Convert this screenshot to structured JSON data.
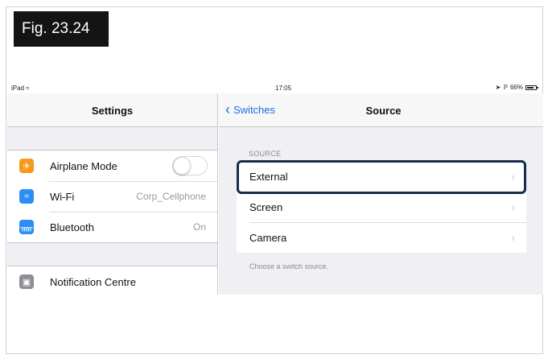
{
  "figure_label": "Fig. 23.24",
  "status_bar": {
    "device": "iPad",
    "time": "17:05",
    "battery": "66%"
  },
  "settings_pane": {
    "title": "Settings",
    "items": [
      {
        "label": "Airplane Mode",
        "icon": "airplane-icon",
        "color": "#f79a1c",
        "toggle": false
      },
      {
        "label": "Wi-Fi",
        "value": "Corp_Cellphone",
        "icon": "wifi-icon",
        "color": "#2b8ef5"
      },
      {
        "label": "Bluetooth",
        "value": "On",
        "icon": "bluetooth-icon",
        "color": "#2b8ef5"
      }
    ],
    "items2": [
      {
        "label": "Notification Centre",
        "icon": "notification-centre-icon",
        "color": "#8e8e93"
      }
    ]
  },
  "source_pane": {
    "back_label": "Switches",
    "title": "Source",
    "section_header": "SOURCE",
    "options": [
      "External",
      "Screen",
      "Camera"
    ],
    "selected": "External",
    "footer": "Choose a switch source."
  },
  "colors": {
    "accent": "#1a6fe0",
    "highlight_border": "#182c4a"
  }
}
